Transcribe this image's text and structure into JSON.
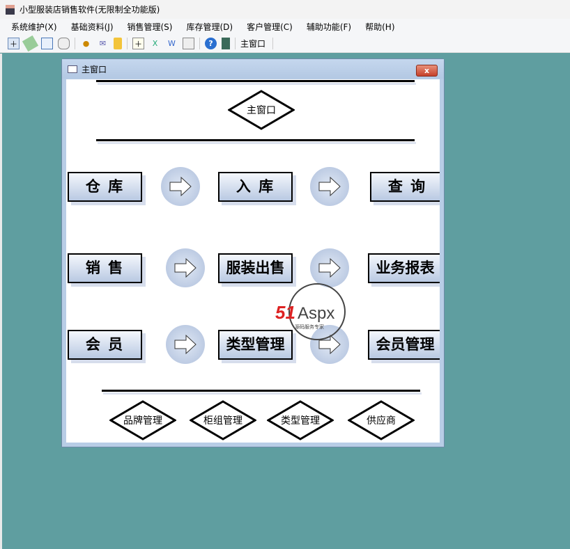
{
  "app": {
    "title": "小型服装店销售软件(无限制全功能版)"
  },
  "menu": [
    "系统维护(X)",
    "基础资料(J)",
    "销售管理(S)",
    "库存管理(D)",
    "客户管理(C)",
    "辅助功能(F)",
    "帮助(H)"
  ],
  "toolbar": {
    "main_window_label": "主窗口"
  },
  "window": {
    "title": "主窗口",
    "close_label": "x",
    "header_diamond": "主窗口",
    "rows": [
      {
        "buttons": [
          "仓 库",
          "入 库",
          "查 询"
        ]
      },
      {
        "buttons": [
          "销 售",
          "服装出售",
          "业务报表"
        ]
      },
      {
        "buttons": [
          "会 员",
          "类型管理",
          "会员管理"
        ]
      }
    ],
    "bottom_diamonds": [
      "品牌管理",
      "柜组管理",
      "类型管理",
      "供应商"
    ]
  },
  "watermark": {
    "brand": "51Aspx",
    "tagline": "源码服务专家"
  }
}
